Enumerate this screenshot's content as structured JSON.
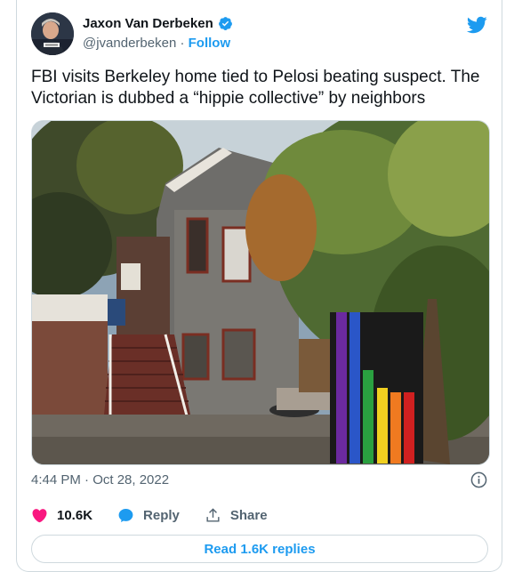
{
  "author": {
    "name": "Jaxon Van Derbeken",
    "handle": "@jvanderbeken",
    "separator": "·",
    "follow_label": "Follow"
  },
  "tweet": {
    "text": "FBI visits Berkeley home tied to Pelosi beating suspect. The Victorian is dubbed a “hippie collective” by neighbors",
    "timestamp": "4:44 PM · Oct 28, 2022"
  },
  "actions": {
    "likes": "10.6K",
    "reply_label": "Reply",
    "share_label": "Share"
  },
  "replies_button": "Read 1.6K replies",
  "colors": {
    "accent": "#1d9bf0",
    "like": "#f91880",
    "text": "#0f1419",
    "muted": "#536471",
    "border": "#cfd9de"
  },
  "icons": [
    "verified-badge-icon",
    "twitter-bird-icon",
    "info-icon",
    "heart-icon",
    "reply-bubble-icon",
    "share-icon"
  ]
}
